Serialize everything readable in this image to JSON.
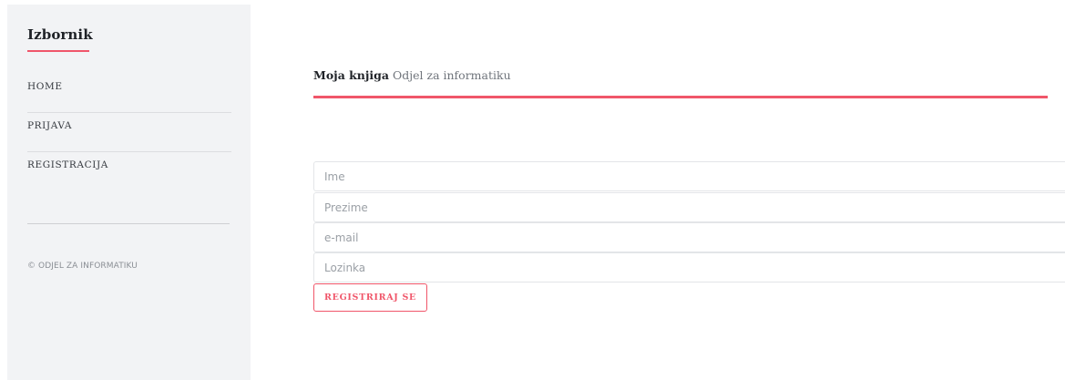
{
  "sidebar": {
    "title": "Izbornik",
    "items": [
      {
        "label": "HOME"
      },
      {
        "label": "PRIJAVA"
      },
      {
        "label": "REGISTRACIJA"
      }
    ],
    "copyright": "© ODJEL ZA INFORMATIKU"
  },
  "header": {
    "brand": "Moja knjiga",
    "subtitle": "Odjel za informatiku"
  },
  "form": {
    "fields": [
      {
        "placeholder": "Ime",
        "value": ""
      },
      {
        "placeholder": "Prezime",
        "value": ""
      },
      {
        "placeholder": "e-mail",
        "value": ""
      },
      {
        "placeholder": "Lozinka",
        "value": ""
      }
    ],
    "submit_label": "REGISTRIRAJ SE"
  },
  "colors": {
    "accent": "#f0566a",
    "sidebar_bg": "#f2f3f5",
    "text_dark": "#1f2227"
  }
}
